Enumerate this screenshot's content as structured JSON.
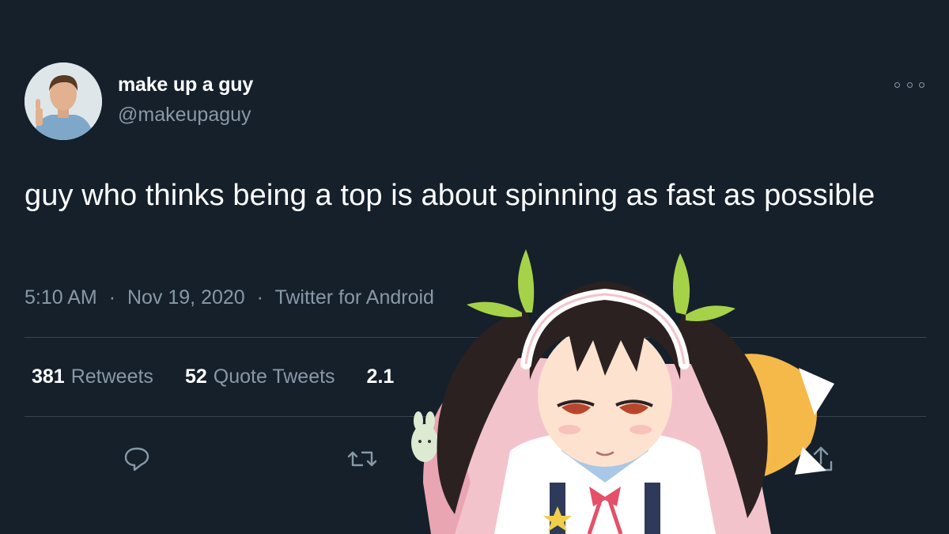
{
  "author": {
    "display_name": "make up a guy",
    "handle": "@makeupaguy"
  },
  "tweet": {
    "text": "guy who thinks being a top is about spinning as fast as possible",
    "time": "5:10 AM",
    "date": "Nov 19, 2020",
    "source": "Twitter for Android",
    "separator": "·"
  },
  "stats": {
    "retweets": {
      "count": "381",
      "label": "Retweets"
    },
    "quote_tweets": {
      "count": "52",
      "label": "Quote Tweets"
    },
    "likes": {
      "count": "2.1",
      "label": ""
    }
  },
  "actions": [
    "reply-icon",
    "retweet-icon",
    "like-icon",
    "share-icon"
  ],
  "overlay": {
    "description_icon": "anime-girl-sticker"
  },
  "colors": {
    "background": "#15202b",
    "text": "#ffffff",
    "secondary_text": "#8899a6",
    "divider": "#38444d"
  }
}
